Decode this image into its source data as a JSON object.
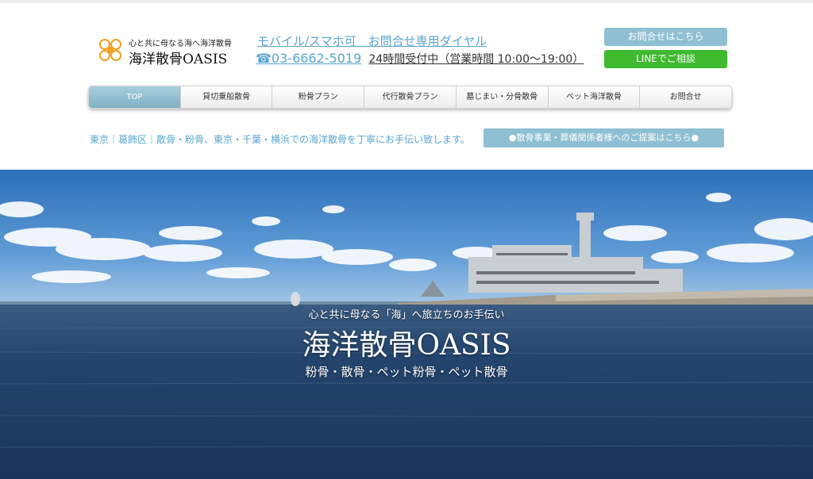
{
  "header": {
    "logo_tagline": "心と共に母なる海へ海洋散骨",
    "logo_name": "海洋散骨OASIS",
    "logo_icon": "flower-logo-icon",
    "contact_title": "モバイル/スマホ可　お問合せ専用ダイヤル",
    "phone": "☎03-6662-5019",
    "hours": "24時間受付中（営業時間 10:00〜19:00）",
    "inquiry_button": "お問合せはこちら",
    "line_button": "LINEでご相談"
  },
  "nav": {
    "items": [
      {
        "label": "TOP"
      },
      {
        "label": "貸切乗船散骨"
      },
      {
        "label": "粉骨プラン"
      },
      {
        "label": "代行散骨プラン"
      },
      {
        "label": "墓じまい・分骨散骨"
      },
      {
        "label": "ペット海洋散骨"
      },
      {
        "label": "お問合せ"
      }
    ]
  },
  "tagline": "東京｜葛飾区｜散骨・粉骨、東京・千葉・横浜での海洋散骨を丁寧にお手伝い致します。",
  "proposal_button": "●散骨事業・葬儀関係者様へのご提案はこちら●",
  "hero": {
    "subtitle": "心と共に母なる「海」へ旅立ちのお手伝い",
    "title": "海洋散骨OASIS",
    "services": "粉骨・散骨・ペット粉骨・ペット散骨"
  },
  "colors": {
    "accent_blue": "#5aa5cf",
    "button_blue": "#8ebfd2",
    "line_green": "#3fba2f",
    "sea": "#1f3f66"
  }
}
